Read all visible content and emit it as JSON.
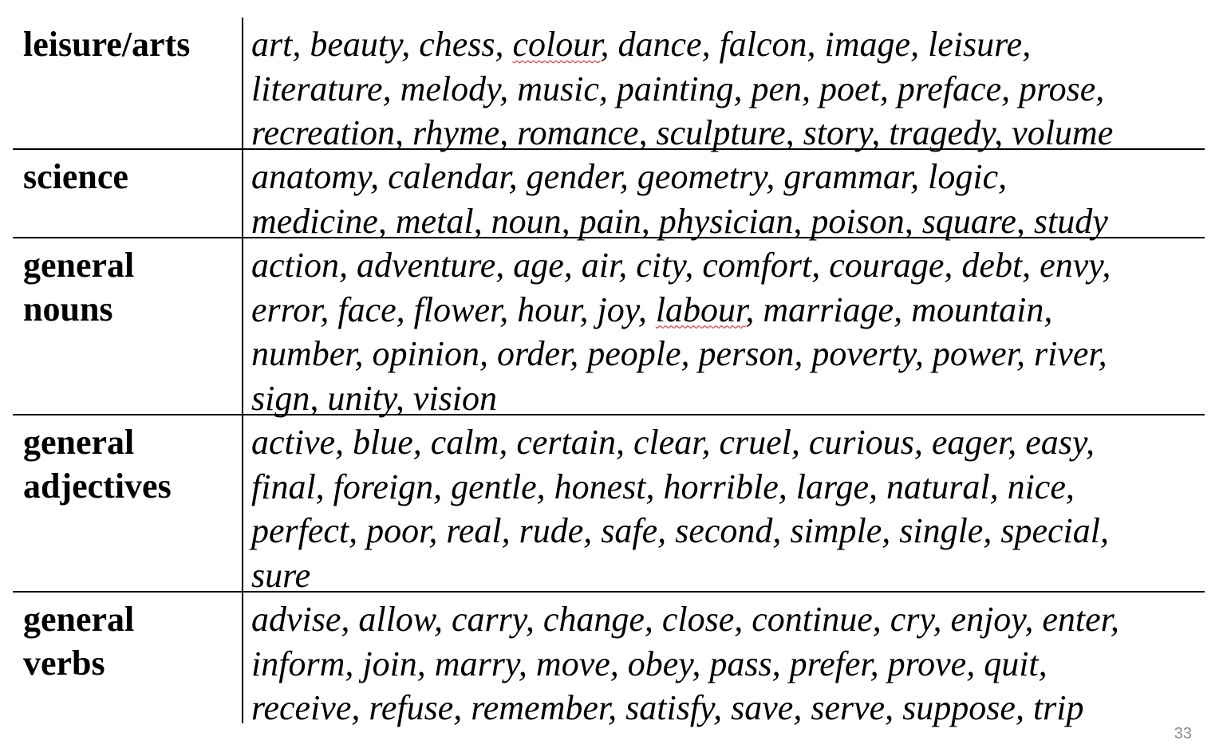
{
  "table": {
    "rows": [
      {
        "category_lines": [
          "leisure/arts"
        ],
        "word_lines": [
          "art, beauty, chess, colour, dance, falcon, image, leisure,",
          "literature, melody, music, painting, pen, poet, preface, prose,",
          "recreation, rhyme, romance, sculpture, story, tragedy, volume"
        ]
      },
      {
        "category_lines": [
          "science"
        ],
        "word_lines": [
          "anatomy, calendar, gender, geometry, grammar, logic,",
          "medicine, metal, noun, pain, physician, poison, square, study"
        ]
      },
      {
        "category_lines": [
          "general",
          "nouns"
        ],
        "word_lines": [
          "action, adventure, age, air, city, comfort, courage, debt, envy,",
          "error, face, flower, hour, joy, labour, marriage, mountain,",
          "number, opinion, order, people, person, poverty, power, river,",
          "sign, unity, vision"
        ]
      },
      {
        "category_lines": [
          "general",
          "adjectives"
        ],
        "word_lines": [
          "active, blue, calm, certain, clear, cruel, curious, eager, easy,",
          "final, foreign, gentle, honest, horrible, large, natural, nice,",
          "perfect, poor, real, rude, safe, second, simple, single, special,",
          "sure"
        ]
      },
      {
        "category_lines": [
          "general",
          "verbs"
        ],
        "word_lines": [
          "advise, allow, carry, change, close, continue, cry, enjoy, enter,",
          "inform, join, marry, move, obey, pass, prefer, prove, quit,",
          "receive, refuse, remember, satisfy, save, serve, suppose, trip"
        ]
      }
    ]
  },
  "spellcheck_words": [
    "colour",
    "labour"
  ],
  "page_number": "33"
}
